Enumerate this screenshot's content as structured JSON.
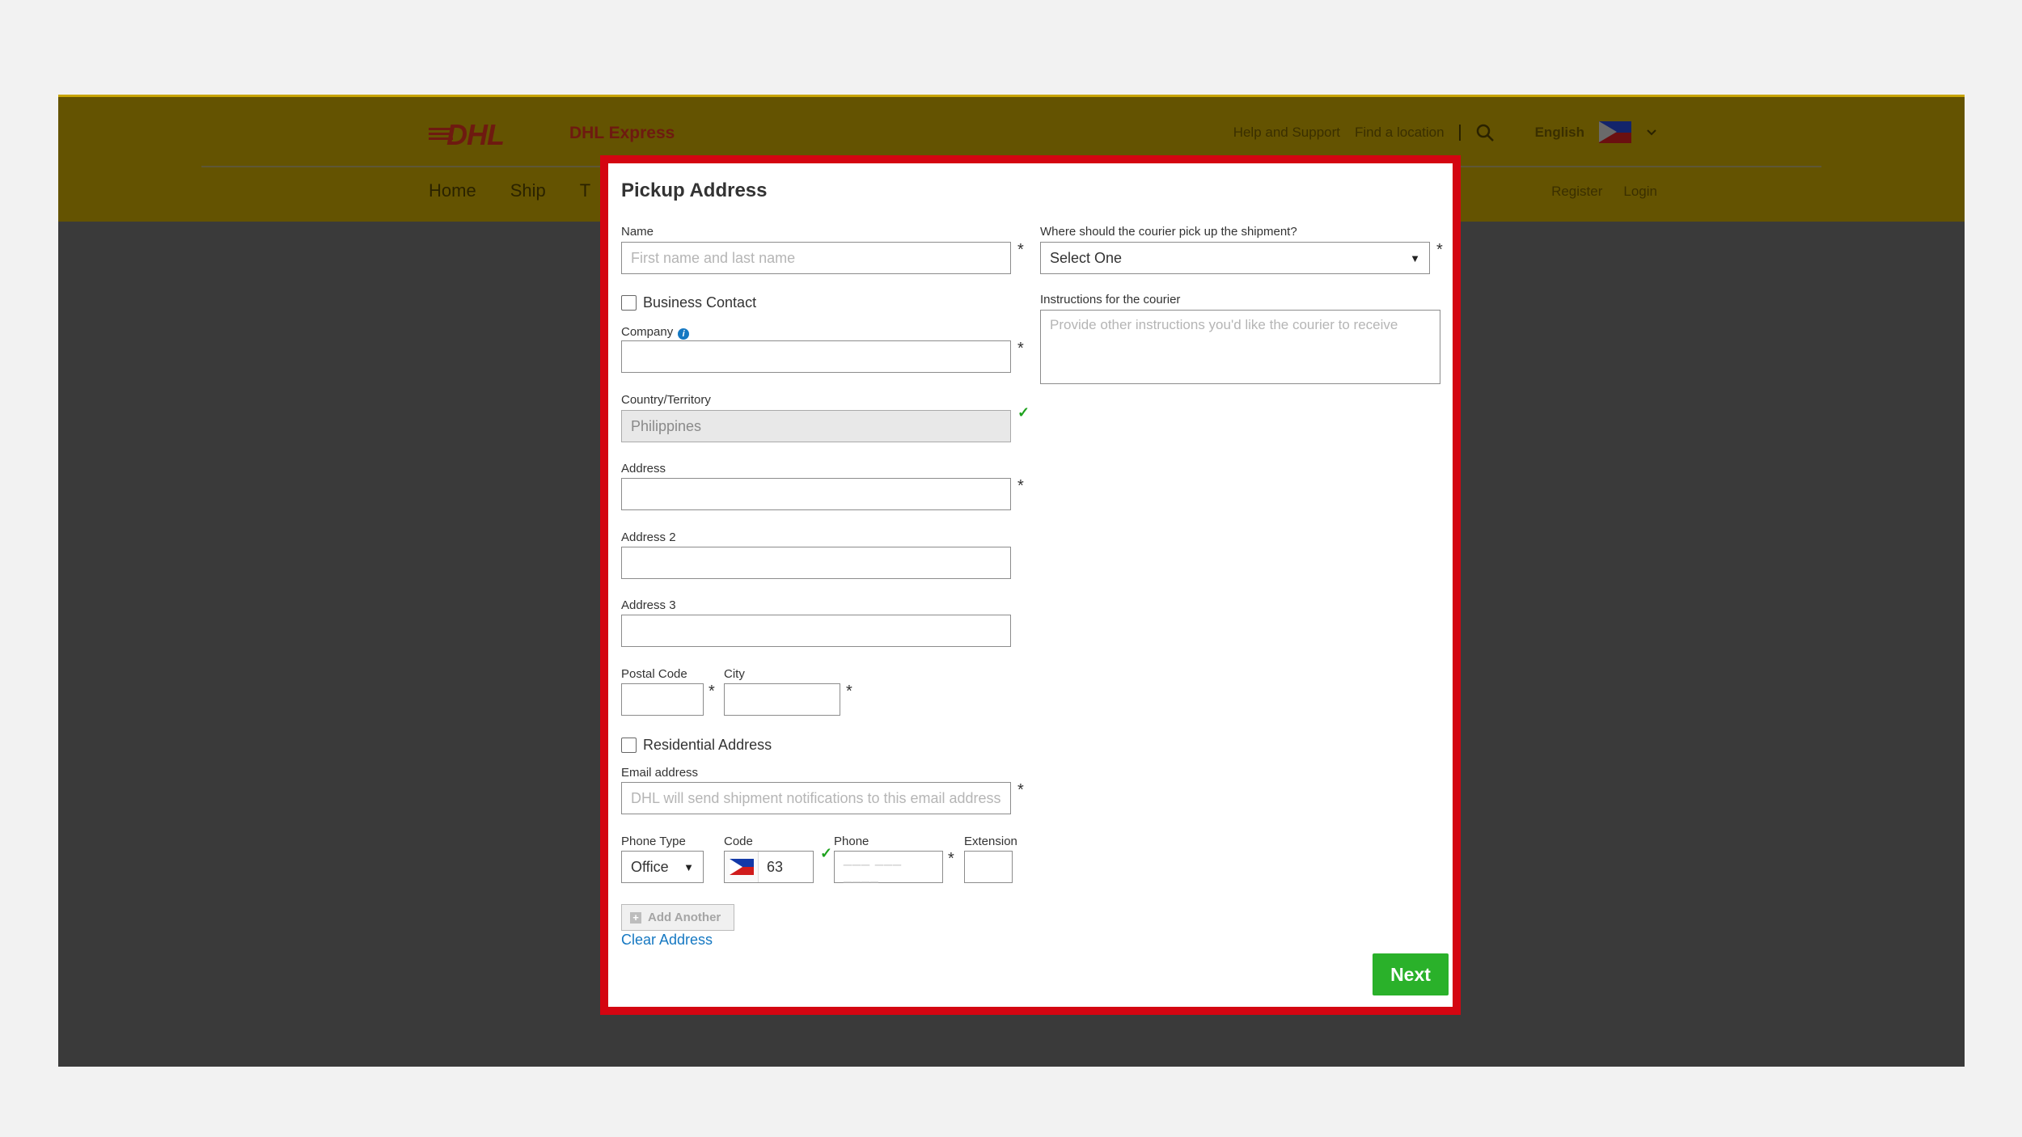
{
  "header": {
    "brand": "DHL Express",
    "logo_text": "DHL",
    "links": [
      "Help and Support",
      "Find a location"
    ],
    "language": "English",
    "nav": [
      "Home",
      "Ship",
      "T"
    ],
    "nav_right": [
      "Register",
      "Login"
    ]
  },
  "modal": {
    "title": "Pickup Address",
    "name": {
      "label": "Name",
      "placeholder": "First name and last name"
    },
    "business_contact": "Business Contact",
    "company": {
      "label": "Company",
      "value": ""
    },
    "country": {
      "label": "Country/Territory",
      "value": "Philippines"
    },
    "address": {
      "label": "Address",
      "value": ""
    },
    "address2": {
      "label": "Address 2",
      "value": ""
    },
    "address3": {
      "label": "Address 3",
      "value": ""
    },
    "postal": {
      "label": "Postal Code",
      "value": ""
    },
    "city": {
      "label": "City",
      "value": ""
    },
    "residential": "Residential Address",
    "email": {
      "label": "Email address",
      "placeholder": "DHL will send shipment notifications to this email address"
    },
    "phone_type": {
      "label": "Phone Type",
      "value": "Office"
    },
    "code": {
      "label": "Code",
      "value": "63"
    },
    "phone": {
      "label": "Phone",
      "mask": "___ ___ ____"
    },
    "extension": {
      "label": "Extension",
      "value": ""
    },
    "add_another": "Add Another",
    "clear_address": "Clear Address",
    "pickup_location": {
      "label": "Where should the courier pick up the shipment?",
      "value": "Select One"
    },
    "instructions": {
      "label": "Instructions for the courier",
      "placeholder": "Provide other instructions you'd like the courier to receive"
    },
    "next": "Next",
    "required_mark": "*",
    "valid_mark": "✓"
  },
  "colors": {
    "frame": "#d40511",
    "next": "#2ab12a",
    "link": "#1578c2"
  },
  "icons": [
    "search-icon",
    "chevron-down-icon",
    "info-icon",
    "check-icon",
    "plus-icon",
    "flag-icon"
  ]
}
